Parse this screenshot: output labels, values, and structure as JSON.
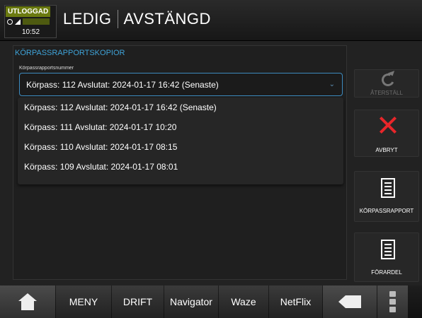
{
  "header": {
    "login_status": "UTLOGGAD",
    "clock": "10:52",
    "status_primary": "LEDIG",
    "status_secondary": "AVSTÄNGD"
  },
  "panel": {
    "section_title": "KÖRPASSRAPPORTSKOPIOR",
    "field_label": "Körpassrapportsnummer",
    "selected_value": "Körpass: 112  Avslutat: 2024-01-17 16:42  (Senaste)",
    "options": [
      "Körpass: 112  Avslutat: 2024-01-17 16:42  (Senaste)",
      "Körpass: 111  Avslutat: 2024-01-17 10:20",
      "Körpass: 110  Avslutat: 2024-01-17 08:15",
      "Körpass: 109  Avslutat: 2024-01-17 08:01"
    ]
  },
  "side_buttons": {
    "reset": "ÅTERSTÄLL",
    "cancel": "AVBRYT",
    "report": "KÖRPASSRAPPORT",
    "driver_share": "FÖRARDEL"
  },
  "nav": {
    "menu": "MENY",
    "operation": "DRIFT",
    "navigator": "Navigator",
    "waze": "Waze",
    "netflix": "NetFlix"
  },
  "icons": {
    "home": "home-icon",
    "back": "back-icon",
    "more": "kebab-icon",
    "reset": "refresh-icon",
    "cancel": "close-icon",
    "document": "document-icon"
  },
  "colors": {
    "accent_blue": "#3fa3d8",
    "cancel_red": "#e8262a",
    "login_badge": "#6b7a10"
  }
}
